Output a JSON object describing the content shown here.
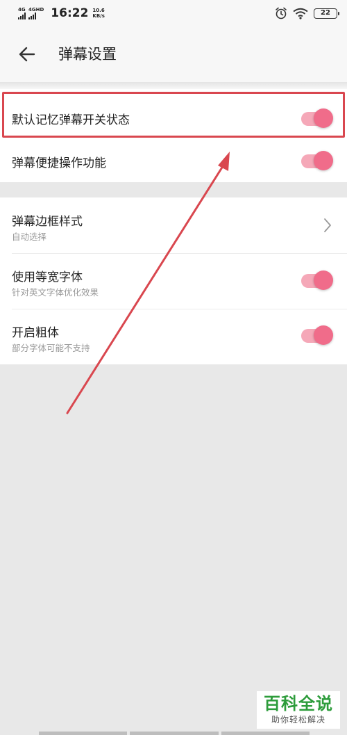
{
  "status_bar": {
    "sim1_label": "4G",
    "sim2_label": "4GHD",
    "time": "16:22",
    "speed_value": "10.6",
    "speed_unit": "KB/s",
    "battery": "22"
  },
  "header": {
    "title": "弹幕设置"
  },
  "settings": {
    "group1": [
      {
        "label": "默认记忆弹幕开关状态",
        "toggle_on": true
      },
      {
        "label": "弹幕便捷操作功能",
        "toggle_on": true
      }
    ],
    "group2": [
      {
        "label": "弹幕边框样式",
        "sub": "自动选择"
      },
      {
        "label": "使用等宽字体",
        "sub": "针对英文字体优化效果",
        "toggle_on": true
      },
      {
        "label": "开启粗体",
        "sub": "部分字体可能不支持",
        "toggle_on": true
      }
    ]
  },
  "annotation": {
    "highlight_color": "#d9474f"
  },
  "colors": {
    "accent": "#f06c8a",
    "accent_track": "#f5a8b8",
    "background": "#e8e8e8"
  },
  "watermark": {
    "main": "百科全说",
    "sub": "助你轻松解决"
  }
}
